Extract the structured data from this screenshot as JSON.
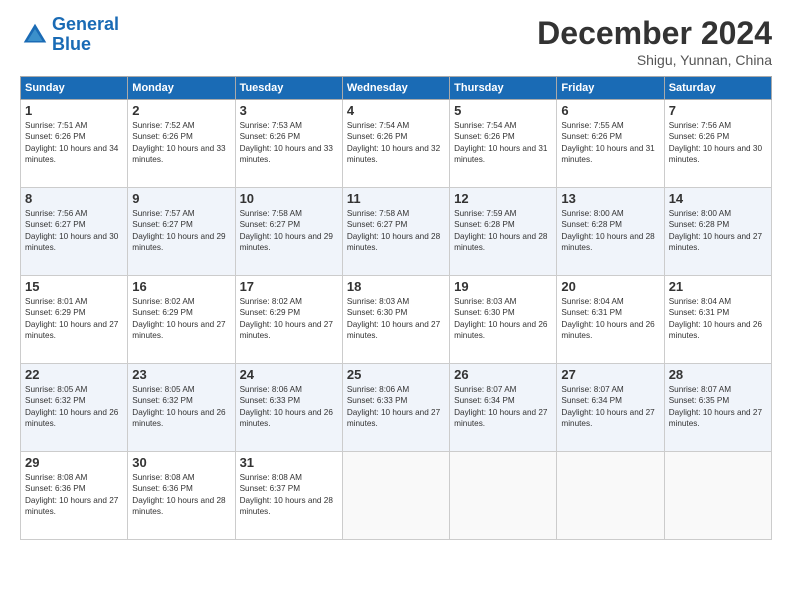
{
  "logo": {
    "line1": "General",
    "line2": "Blue"
  },
  "title": "December 2024",
  "location": "Shigu, Yunnan, China",
  "headers": [
    "Sunday",
    "Monday",
    "Tuesday",
    "Wednesday",
    "Thursday",
    "Friday",
    "Saturday"
  ],
  "weeks": [
    [
      {
        "day": "1",
        "sunrise": "7:51 AM",
        "sunset": "6:26 PM",
        "daylight": "10 hours and 34 minutes."
      },
      {
        "day": "2",
        "sunrise": "7:52 AM",
        "sunset": "6:26 PM",
        "daylight": "10 hours and 33 minutes."
      },
      {
        "day": "3",
        "sunrise": "7:53 AM",
        "sunset": "6:26 PM",
        "daylight": "10 hours and 33 minutes."
      },
      {
        "day": "4",
        "sunrise": "7:54 AM",
        "sunset": "6:26 PM",
        "daylight": "10 hours and 32 minutes."
      },
      {
        "day": "5",
        "sunrise": "7:54 AM",
        "sunset": "6:26 PM",
        "daylight": "10 hours and 31 minutes."
      },
      {
        "day": "6",
        "sunrise": "7:55 AM",
        "sunset": "6:26 PM",
        "daylight": "10 hours and 31 minutes."
      },
      {
        "day": "7",
        "sunrise": "7:56 AM",
        "sunset": "6:26 PM",
        "daylight": "10 hours and 30 minutes."
      }
    ],
    [
      {
        "day": "8",
        "sunrise": "7:56 AM",
        "sunset": "6:27 PM",
        "daylight": "10 hours and 30 minutes."
      },
      {
        "day": "9",
        "sunrise": "7:57 AM",
        "sunset": "6:27 PM",
        "daylight": "10 hours and 29 minutes."
      },
      {
        "day": "10",
        "sunrise": "7:58 AM",
        "sunset": "6:27 PM",
        "daylight": "10 hours and 29 minutes."
      },
      {
        "day": "11",
        "sunrise": "7:58 AM",
        "sunset": "6:27 PM",
        "daylight": "10 hours and 28 minutes."
      },
      {
        "day": "12",
        "sunrise": "7:59 AM",
        "sunset": "6:28 PM",
        "daylight": "10 hours and 28 minutes."
      },
      {
        "day": "13",
        "sunrise": "8:00 AM",
        "sunset": "6:28 PM",
        "daylight": "10 hours and 28 minutes."
      },
      {
        "day": "14",
        "sunrise": "8:00 AM",
        "sunset": "6:28 PM",
        "daylight": "10 hours and 27 minutes."
      }
    ],
    [
      {
        "day": "15",
        "sunrise": "8:01 AM",
        "sunset": "6:29 PM",
        "daylight": "10 hours and 27 minutes."
      },
      {
        "day": "16",
        "sunrise": "8:02 AM",
        "sunset": "6:29 PM",
        "daylight": "10 hours and 27 minutes."
      },
      {
        "day": "17",
        "sunrise": "8:02 AM",
        "sunset": "6:29 PM",
        "daylight": "10 hours and 27 minutes."
      },
      {
        "day": "18",
        "sunrise": "8:03 AM",
        "sunset": "6:30 PM",
        "daylight": "10 hours and 27 minutes."
      },
      {
        "day": "19",
        "sunrise": "8:03 AM",
        "sunset": "6:30 PM",
        "daylight": "10 hours and 26 minutes."
      },
      {
        "day": "20",
        "sunrise": "8:04 AM",
        "sunset": "6:31 PM",
        "daylight": "10 hours and 26 minutes."
      },
      {
        "day": "21",
        "sunrise": "8:04 AM",
        "sunset": "6:31 PM",
        "daylight": "10 hours and 26 minutes."
      }
    ],
    [
      {
        "day": "22",
        "sunrise": "8:05 AM",
        "sunset": "6:32 PM",
        "daylight": "10 hours and 26 minutes."
      },
      {
        "day": "23",
        "sunrise": "8:05 AM",
        "sunset": "6:32 PM",
        "daylight": "10 hours and 26 minutes."
      },
      {
        "day": "24",
        "sunrise": "8:06 AM",
        "sunset": "6:33 PM",
        "daylight": "10 hours and 26 minutes."
      },
      {
        "day": "25",
        "sunrise": "8:06 AM",
        "sunset": "6:33 PM",
        "daylight": "10 hours and 27 minutes."
      },
      {
        "day": "26",
        "sunrise": "8:07 AM",
        "sunset": "6:34 PM",
        "daylight": "10 hours and 27 minutes."
      },
      {
        "day": "27",
        "sunrise": "8:07 AM",
        "sunset": "6:34 PM",
        "daylight": "10 hours and 27 minutes."
      },
      {
        "day": "28",
        "sunrise": "8:07 AM",
        "sunset": "6:35 PM",
        "daylight": "10 hours and 27 minutes."
      }
    ],
    [
      {
        "day": "29",
        "sunrise": "8:08 AM",
        "sunset": "6:36 PM",
        "daylight": "10 hours and 27 minutes."
      },
      {
        "day": "30",
        "sunrise": "8:08 AM",
        "sunset": "6:36 PM",
        "daylight": "10 hours and 28 minutes."
      },
      {
        "day": "31",
        "sunrise": "8:08 AM",
        "sunset": "6:37 PM",
        "daylight": "10 hours and 28 minutes."
      },
      null,
      null,
      null,
      null
    ]
  ]
}
